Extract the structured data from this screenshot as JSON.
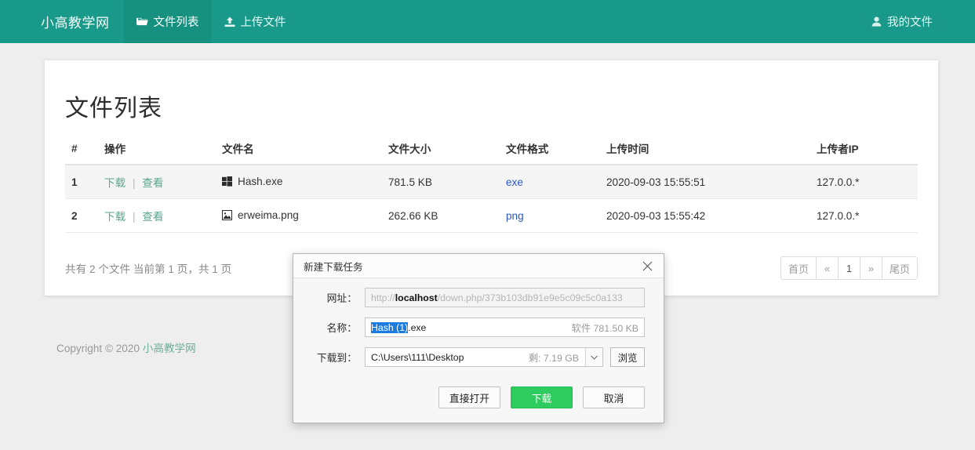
{
  "navbar": {
    "brand": "小高教学网",
    "items": [
      {
        "label": "文件列表",
        "icon": "folder-open-icon",
        "active": true
      },
      {
        "label": "上传文件",
        "icon": "upload-icon",
        "active": false
      }
    ],
    "right": {
      "label": "我的文件",
      "icon": "user-icon"
    },
    "bg_color": "#18998a",
    "active_bg_color": "#17917f"
  },
  "main": {
    "title": "文件列表",
    "table": {
      "headers": [
        "#",
        "操作",
        "文件名",
        "文件大小",
        "文件格式",
        "上传时间",
        "上传者IP"
      ],
      "op_download": "下载",
      "op_view": "查看",
      "rows": [
        {
          "index": "1",
          "download": "下载",
          "view": "查看",
          "filename": "Hash.exe",
          "file_icon": "windows-logo-icon",
          "size": "781.5 KB",
          "format": "exe",
          "uploaded": "2020-09-03 15:55:51",
          "ip": "127.0.0.*"
        },
        {
          "index": "2",
          "download": "下载",
          "view": "查看",
          "filename": "erweima.png",
          "file_icon": "image-file-icon",
          "size": "262.66 KB",
          "format": "png",
          "uploaded": "2020-09-03 15:55:42",
          "ip": "127.0.0.*"
        }
      ]
    },
    "summary": "共有 2 个文件 当前第 1 页，共 1 页",
    "pagination": {
      "first": "首页",
      "prev": "«",
      "current": "1",
      "next": "»",
      "last": "尾页"
    }
  },
  "footer": {
    "copyright_prefix": "Copyright © 2020 ",
    "site_name": "小高教学网",
    "link_color": "#6fae9c"
  },
  "dialog": {
    "title": "新建下载任务",
    "close_icon": "close-icon",
    "url_label": "网址：",
    "url": {
      "scheme": "http://",
      "host": "localhost",
      "path": "/down.php/373b103db91e9e5c09c5c0a133"
    },
    "name_label": "名称：",
    "name_selected": "Hash (1)",
    "name_rest": ".exe",
    "name_meta": "软件 781.50 KB",
    "path_label": "下载到：",
    "path_value": "C:\\Users\\111\\Desktop",
    "path_free": "剩: 7.19 GB",
    "dropdown_icon": "chevron-down-icon",
    "browse_label": "浏览",
    "buttons": {
      "open": "直接打开",
      "download": "下载",
      "cancel": "取消"
    },
    "primary_color": "#2ecc5e"
  }
}
